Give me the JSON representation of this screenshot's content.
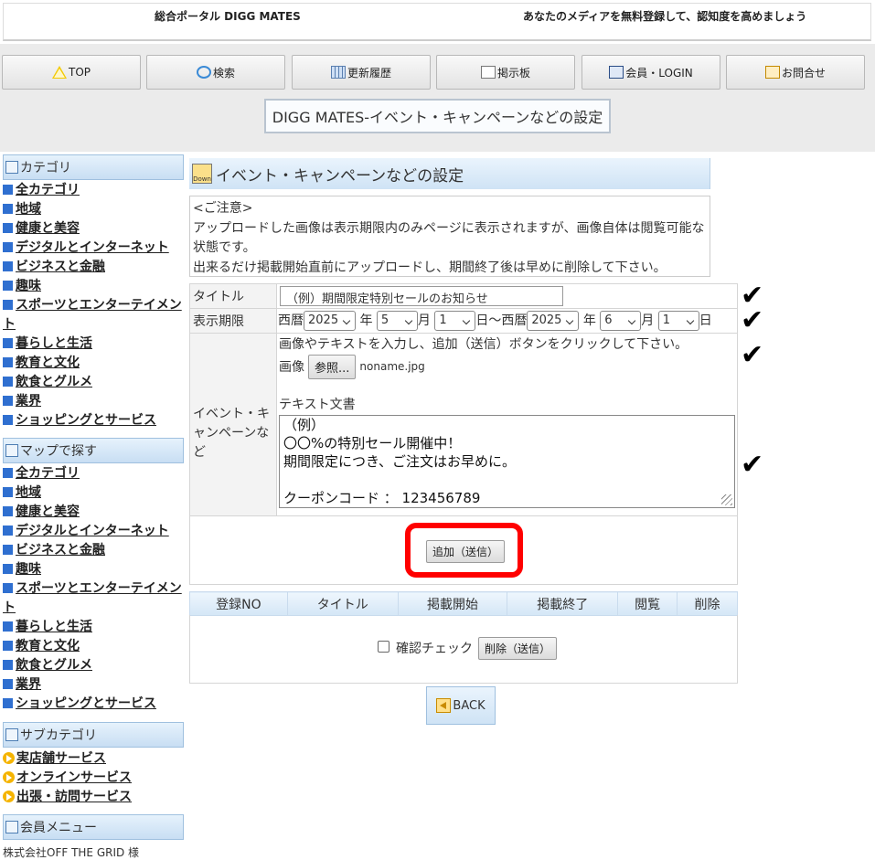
{
  "header": {
    "site_name": "総合ポータル DIGG MATES",
    "tagline": "あなたのメディアを無料登録して、認知度を高めましょう"
  },
  "nav": [
    {
      "label": "TOP",
      "icon": "warning-triangle-icon"
    },
    {
      "label": "検索",
      "icon": "search-icon"
    },
    {
      "label": "更新履歴",
      "icon": "grid-icon"
    },
    {
      "label": "掲示板",
      "icon": "board-icon"
    },
    {
      "label": "会員・LOGIN",
      "icon": "member-card-icon"
    },
    {
      "label": "お問合せ",
      "icon": "mail-icon"
    }
  ],
  "page_title": "DIGG MATES-イベント・キャンペーンなどの設定",
  "sidebar": {
    "category_heading": "カテゴリ",
    "categories": [
      "全カテゴリ",
      "地域",
      "健康と美容",
      "デジタルとインターネット",
      "ビジネスと金融",
      "趣味",
      "スポーツとエンターテイメント",
      "暮らしと生活",
      "教育と文化",
      "飲食とグルメ",
      "業界",
      "ショッピングとサービス"
    ],
    "map_heading": "マップで探す",
    "map_categories": [
      "全カテゴリ",
      "地域",
      "健康と美容",
      "デジタルとインターネット",
      "ビジネスと金融",
      "趣味",
      "スポーツとエンターテイメント",
      "暮らしと生活",
      "教育と文化",
      "飲食とグルメ",
      "業界",
      "ショッピングとサービス"
    ],
    "sub_heading": "サブカテゴリ",
    "subcategories": [
      "実店舗サービス",
      "オンラインサービス",
      "出張・訪問サービス"
    ],
    "member_heading": "会員メニュー",
    "footer_text": "株式会社OFF THE GRID 様"
  },
  "main": {
    "heading": "イベント・キャンペーンなどの設定",
    "heading_icon_text": "Down",
    "notice": [
      "<ご注意>",
      "アップロードした画像は表示期限内のみページに表示されますが、画像自体は閲覧可能な",
      "状態です。",
      "出来るだけ掲載開始直前にアップロードし、期間終了後は早めに削除して下さい。"
    ],
    "form": {
      "title_label": "タイトル",
      "title_value": "（例）期間限定特別セールのお知らせ",
      "period_label": "表示期限",
      "era1": "西暦",
      "start_year": "2025",
      "year_unit": "年",
      "start_month": "5",
      "month_unit": "月",
      "start_day": "1",
      "range_sep": "日～西暦",
      "end_year": "2025",
      "end_month": "6",
      "end_day": "1",
      "day_unit": "日",
      "event_label": "イベント・キャンペーンなど",
      "instruction": "画像やテキストを入力し、追加（送信）ボタンをクリックして下さい。",
      "image_label": "画像",
      "browse_label": "参照...",
      "file_name": "noname.jpg",
      "text_label": "テキスト文書",
      "text_value": "（例）\n〇〇%の特別セール開催中！\n期間限定につき、ご注文はお早めに。\n\nクーポンコード ： 123456789",
      "submit_label": "追加（送信）"
    },
    "list": {
      "columns": [
        "登録NO",
        "タイトル",
        "掲載開始",
        "掲載終了",
        "閲覧",
        "削除"
      ],
      "confirm_label": "確認チェック",
      "delete_label": "削除（送信）"
    },
    "back_label": "BACK"
  },
  "annotations": {
    "check_mark": "✔"
  }
}
